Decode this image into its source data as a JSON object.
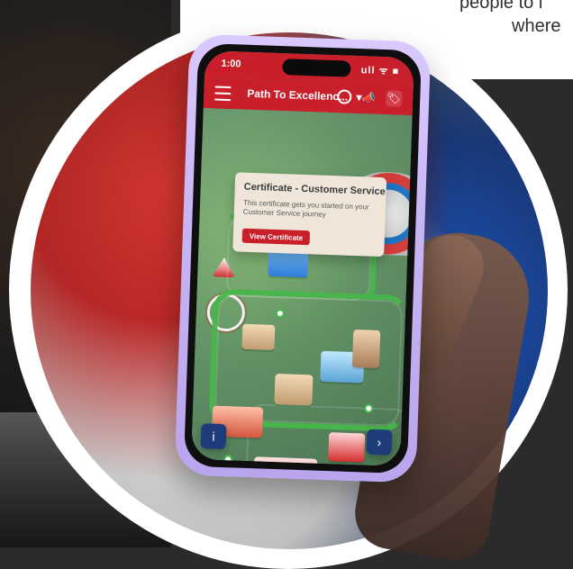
{
  "page": {
    "cutoff_text": {
      "line1": "people to l",
      "line2": "where"
    }
  },
  "phone": {
    "status": {
      "time": "1:00",
      "icons": "ull ᯤ ■"
    },
    "app": {
      "title": "Path To Excellenc...",
      "title_arrow": "▾",
      "icons": [
        "refresh-icon",
        "megaphone-icon",
        "profile-badge-icon"
      ]
    },
    "certificate_popup": {
      "title": "Certificate - Customer Service",
      "description": "This certificate gets you started on your Customer Service journey",
      "button_label": "View Certificate"
    },
    "floating_buttons": {
      "left_icon": "info-icon",
      "right_icon": "chevron-right-icon"
    }
  },
  "colors": {
    "brand_red": "#c91f2b",
    "road_green": "#46b84a",
    "popup_bg": "#efe6d9",
    "fab_blue": "#1f3c7a"
  }
}
